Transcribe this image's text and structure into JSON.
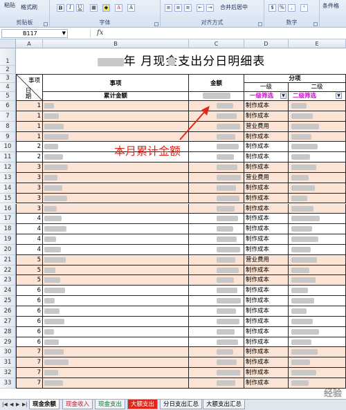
{
  "ribbon": {
    "groups": [
      {
        "name": "剪贴板",
        "buttons": [
          "粘贴",
          "格式刷"
        ]
      },
      {
        "name": "字体",
        "buttons": [
          "B",
          "I",
          "U",
          "A"
        ]
      },
      {
        "name": "对齐方式",
        "buttons": [
          "合并后居中"
        ]
      },
      {
        "name": "数字",
        "buttons": [
          "%",
          ","
        ]
      },
      {
        "name": "",
        "buttons": [
          "条件格"
        ]
      }
    ]
  },
  "formula_bar": {
    "name_box": "B117",
    "fx": "fx"
  },
  "columns": [
    "A",
    "B",
    "C",
    "D",
    "E"
  ],
  "title": "年 月现金支出分日明细表",
  "header": {
    "event_top": "事项",
    "day_bottom": "日期",
    "event": "事项",
    "amount": "金额",
    "category": "分项",
    "level1": "一级",
    "level2": "二级",
    "cumulative": "累计金额",
    "filter1": "一级筛选",
    "filter2": "二级筛选"
  },
  "rows": [
    {
      "n": "6",
      "day": "1",
      "cat": "制作成本"
    },
    {
      "n": "7",
      "day": "1",
      "cat": "制作成本"
    },
    {
      "n": "8",
      "day": "1",
      "cat": "营业费用"
    },
    {
      "n": "9",
      "day": "1",
      "cat": "制作成本"
    },
    {
      "n": "10",
      "day": "2",
      "cat": "制作成本"
    },
    {
      "n": "11",
      "day": "2",
      "cat": "制作成本"
    },
    {
      "n": "12",
      "day": "3",
      "cat": "制作成本"
    },
    {
      "n": "13",
      "day": "3",
      "cat": "营业费用"
    },
    {
      "n": "14",
      "day": "3",
      "cat": "制作成本"
    },
    {
      "n": "15",
      "day": "3",
      "cat": "制作成本"
    },
    {
      "n": "16",
      "day": "3",
      "cat": "制作成本"
    },
    {
      "n": "17",
      "day": "4",
      "cat": "制作成本"
    },
    {
      "n": "18",
      "day": "4",
      "cat": "制作成本"
    },
    {
      "n": "19",
      "day": "4",
      "cat": "制作成本"
    },
    {
      "n": "20",
      "day": "4",
      "cat": "制作成本"
    },
    {
      "n": "21",
      "day": "5",
      "cat": "营业费用"
    },
    {
      "n": "22",
      "day": "5",
      "cat": "制作成本"
    },
    {
      "n": "23",
      "day": "5",
      "cat": "制作成本"
    },
    {
      "n": "24",
      "day": "6",
      "cat": "制作成本"
    },
    {
      "n": "25",
      "day": "6",
      "cat": "制作成本"
    },
    {
      "n": "26",
      "day": "6",
      "cat": "制作成本"
    },
    {
      "n": "27",
      "day": "6",
      "cat": "制作成本"
    },
    {
      "n": "28",
      "day": "6",
      "cat": "制作成本"
    },
    {
      "n": "29",
      "day": "6",
      "cat": "制作成本"
    },
    {
      "n": "30",
      "day": "7",
      "cat": "制作成本"
    },
    {
      "n": "31",
      "day": "7",
      "cat": "制作成本"
    },
    {
      "n": "32",
      "day": "7",
      "cat": "制作成本"
    },
    {
      "n": "33",
      "day": "7",
      "cat": "制作成本"
    }
  ],
  "annotation": "本月累计金额",
  "tabs": [
    "现金余额",
    "现金收入",
    "现金支出",
    "大额支出",
    "分日支出汇总",
    "大额支出汇总"
  ],
  "watermark": "经验"
}
